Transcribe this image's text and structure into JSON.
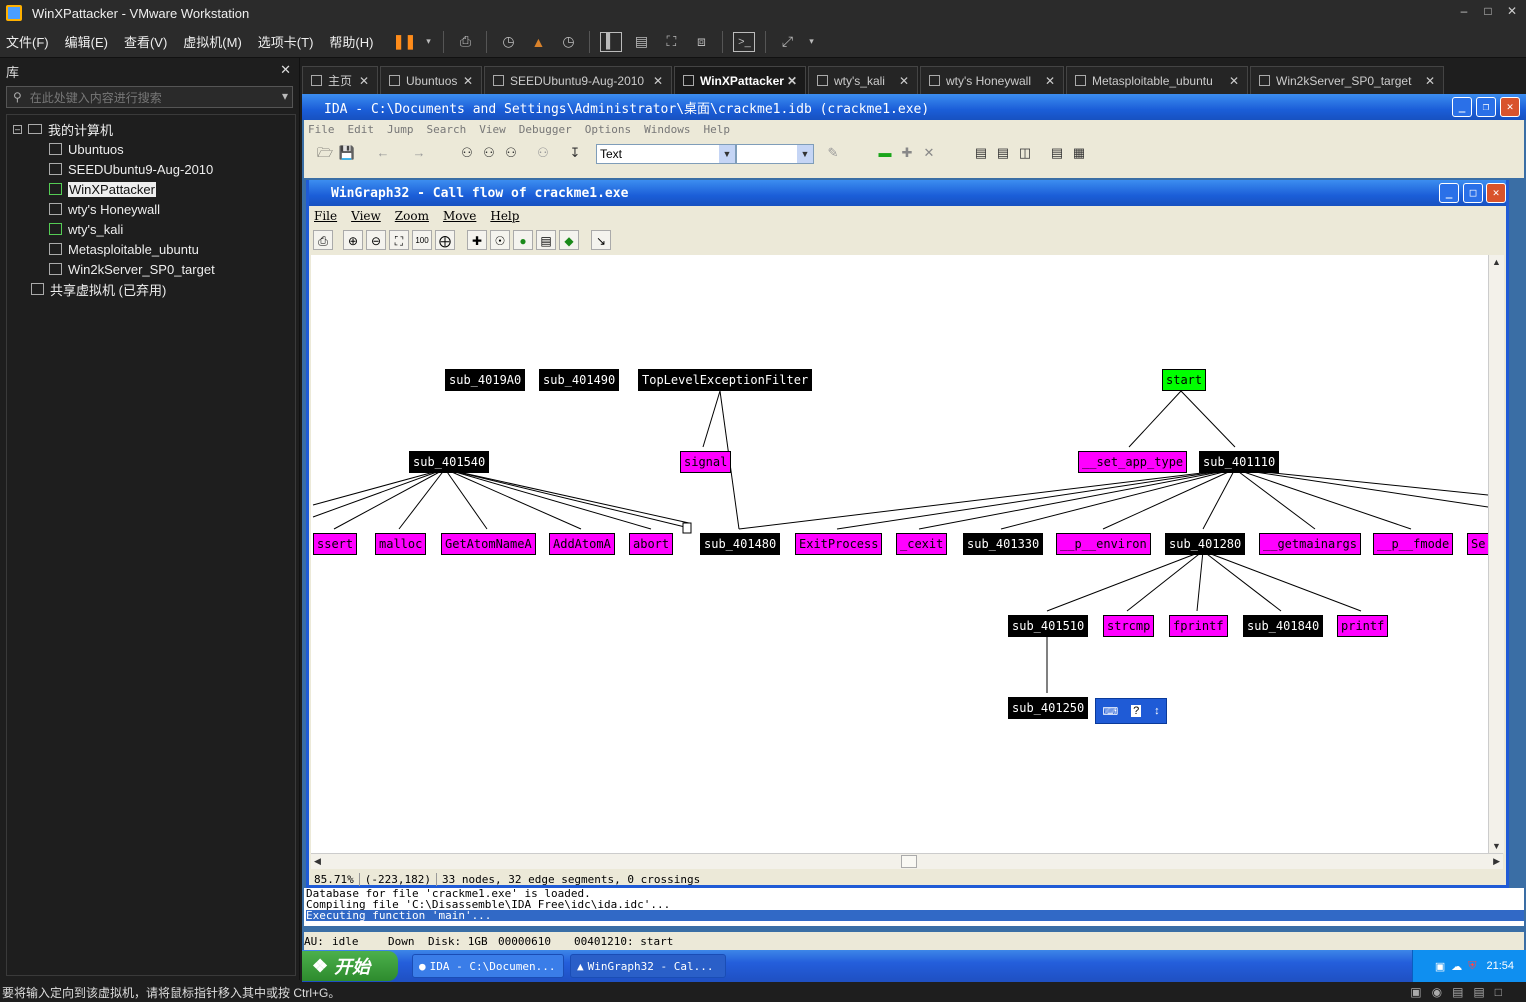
{
  "window": {
    "title": "WinXPattacker - VMware Workstation"
  },
  "menubar": [
    "文件(F)",
    "编辑(E)",
    "查看(V)",
    "虚拟机(M)",
    "选项卡(T)",
    "帮助(H)"
  ],
  "library": {
    "title": "库",
    "search_placeholder": "在此处键入内容进行搜索",
    "root": "我的计算机",
    "vms": [
      "Ubuntuos",
      "SEEDUbuntu9-Aug-2010",
      "WinXPattacker",
      "wty's Honeywall",
      "wty's_kali",
      "Metasploitable_ubuntu",
      "Win2kServer_SP0_target"
    ],
    "shared": "共享虚拟机 (已弃用)"
  },
  "tabs": [
    "主页",
    "Ubuntuos",
    "SEEDUbuntu9-Aug-2010",
    "WinXPattacker",
    "wty's_kali",
    "wty's Honeywall",
    "Metasploitable_ubuntu",
    "Win2kServer_SP0_target"
  ],
  "ida": {
    "title": "IDA - C:\\Documents and Settings\\Administrator\\桌面\\crackme1.idb (crackme1.exe)",
    "menu": [
      "File",
      "Edit",
      "Jump",
      "Search",
      "View",
      "Debugger",
      "Options",
      "Windows",
      "Help"
    ],
    "toolbar_combo": "Text",
    "output": [
      "Database for file 'crackme1.exe' is loaded.",
      "Compiling file 'C:\\Disassemble\\IDA Free\\idc\\ida.idc'...",
      "Executing function 'main'..."
    ],
    "status": {
      "au": "AU:",
      "state": "idle",
      "dir": "Down",
      "disk": "Disk: 1GB",
      "offset": "00000610",
      "location": "00401210: start"
    }
  },
  "wingraph": {
    "title": "WinGraph32 - Call flow of crackme1.exe",
    "menu": [
      "File",
      "View",
      "Zoom",
      "Move",
      "Help"
    ],
    "status": {
      "zoom": "85.71%",
      "coords": "(-223,182)",
      "info": "33 nodes, 32 edge segments, 0 crossings"
    },
    "nodes": {
      "n1": "sub_4019A0",
      "n2": "sub_401490",
      "n3": "TopLevelExceptionFilter",
      "n4": "start",
      "n5": "sub_401540",
      "n6": "signal",
      "n7": "__set_app_type",
      "n8": "sub_401110",
      "n9": "ssert",
      "n10": "malloc",
      "n11": "GetAtomNameA",
      "n12": "AddAtomA",
      "n13": "abort",
      "n14": "sub_401480",
      "n15": "ExitProcess",
      "n16": "_cexit",
      "n17": "sub_401330",
      "n18": "__p__environ",
      "n19": "sub_401280",
      "n20": "__getmainargs",
      "n21": "__p__fmode",
      "n22": "Se",
      "n23": "sub_401510",
      "n24": "strcmp",
      "n25": "fprintf",
      "n26": "sub_401840",
      "n27": "printf",
      "n28": "sub_401250"
    },
    "colors": {
      "black": "#000000",
      "magenta": "#ff00ff",
      "green": "#00ff00"
    }
  },
  "taskbar": {
    "start": "开始",
    "tasks": [
      "IDA - C:\\Documen...",
      "WinGraph32 - Cal..."
    ],
    "clock": "21:54"
  },
  "vm_status": "要将输入定向到该虚拟机，请将鼠标指针移入其中或按 Ctrl+G。"
}
